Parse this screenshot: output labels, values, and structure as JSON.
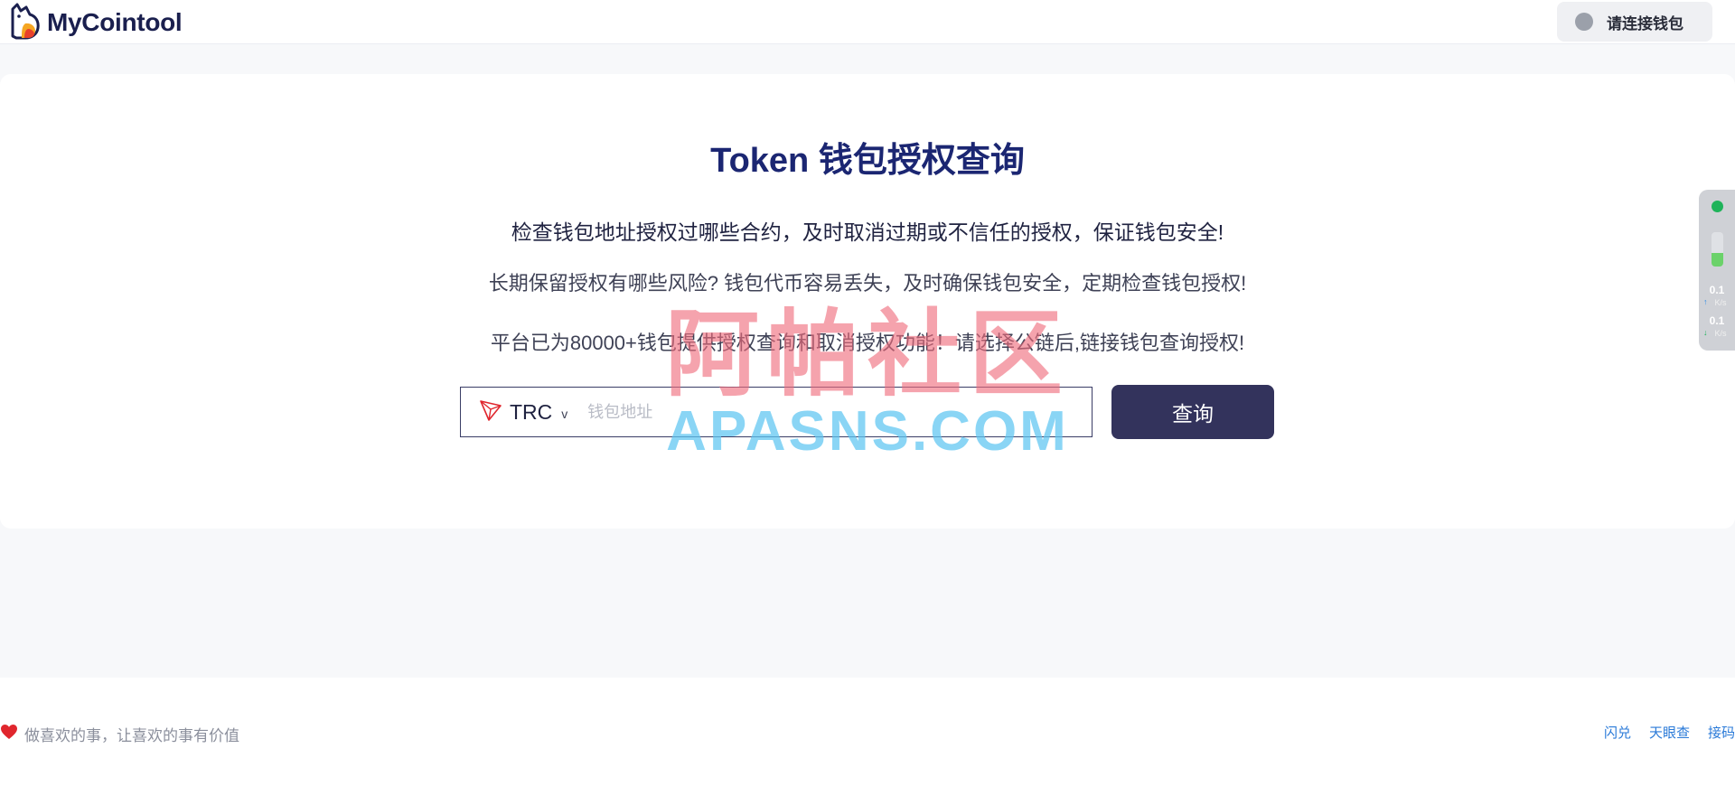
{
  "header": {
    "logo_text": "MyCointool",
    "wallet_button_label": "请连接钱包"
  },
  "main": {
    "title": "Token 钱包授权查询",
    "description_primary": "检查钱包地址授权过哪些合约，及时取消过期或不信任的授权，保证钱包安全!",
    "description_secondary": "长期保留授权有哪些风险? 钱包代币容易丢失，及时确保钱包安全，定期检查钱包授权!",
    "description_tertiary": "平台已为80000+钱包提供授权查询和取消授权功能！请选择公链后,链接钱包查询授权!",
    "search": {
      "chain_label": "TRC",
      "chevron": "v",
      "address_placeholder": "钱包地址",
      "query_button_label": "查询"
    }
  },
  "watermark": {
    "chinese": "阿帕社区",
    "english": "APASNS.COM"
  },
  "speed_widget": {
    "upload_value": "0.1",
    "upload_unit": "K/s",
    "download_value": "0.1",
    "download_unit": "K/s"
  },
  "footer": {
    "slogan": "做喜欢的事，让喜欢的事有价值",
    "links": [
      "闪兑",
      "天眼查",
      "接码"
    ]
  },
  "colors": {
    "brand_navy": "#1b2672",
    "button_dark": "#33335c",
    "link_blue": "#2a7ad8",
    "heart_red": "#e0262d",
    "status_green": "#1fb35a"
  },
  "icons": [
    "logo-icon",
    "tron-icon",
    "chevron-down-icon",
    "heart-icon",
    "upload-arrow-icon",
    "download-arrow-icon"
  ]
}
